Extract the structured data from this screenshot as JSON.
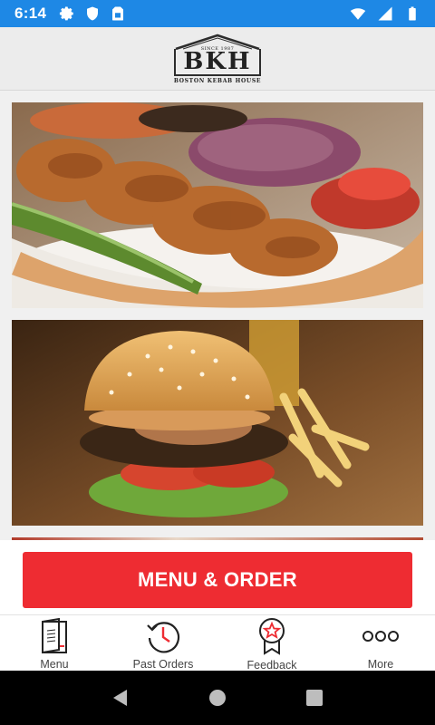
{
  "status_bar": {
    "time": "6:14",
    "left_icons": [
      "gear-icon",
      "shield-icon",
      "sim-card-icon"
    ],
    "right_icons": [
      "wifi-icon",
      "signal-icon",
      "battery-icon"
    ],
    "color": "#1e88e5"
  },
  "header": {
    "logo_letters": "BKH",
    "logo_since": "SINCE 1987",
    "logo_subtitle": "BOSTON KEBAB HOUSE"
  },
  "content": {
    "images": [
      {
        "subject": "kebab-skewers-plate"
      },
      {
        "subject": "burger-with-fries"
      },
      {
        "subject": "partially-visible-dish"
      }
    ]
  },
  "cta": {
    "label": "MENU & ORDER",
    "color": "#ee2c32"
  },
  "tabs": [
    {
      "label": "Menu",
      "icon": "menu-book-icon"
    },
    {
      "label": "Past Orders",
      "icon": "history-clock-icon"
    },
    {
      "label": "Feedback",
      "icon": "award-ribbon-icon"
    },
    {
      "label": "More",
      "icon": "more-dots-icon"
    }
  ],
  "nav": {
    "buttons": [
      "back-icon",
      "home-icon",
      "recents-icon"
    ]
  }
}
